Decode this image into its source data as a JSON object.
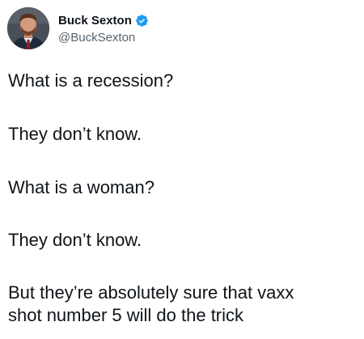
{
  "author": {
    "display_name": "Buck Sexton",
    "handle": "@BuckSexton",
    "verified": true,
    "avatar_icon": "profile-photo",
    "verified_icon": "verified-badge-icon",
    "verified_color": "#1d9bf0"
  },
  "tweet": {
    "lines": [
      "What is a recession?",
      "They don’t know.",
      "What is a woman?",
      "They don’t know.",
      "But they’re absolutely sure that vaxx",
      "shot number 5 will do the trick"
    ]
  }
}
